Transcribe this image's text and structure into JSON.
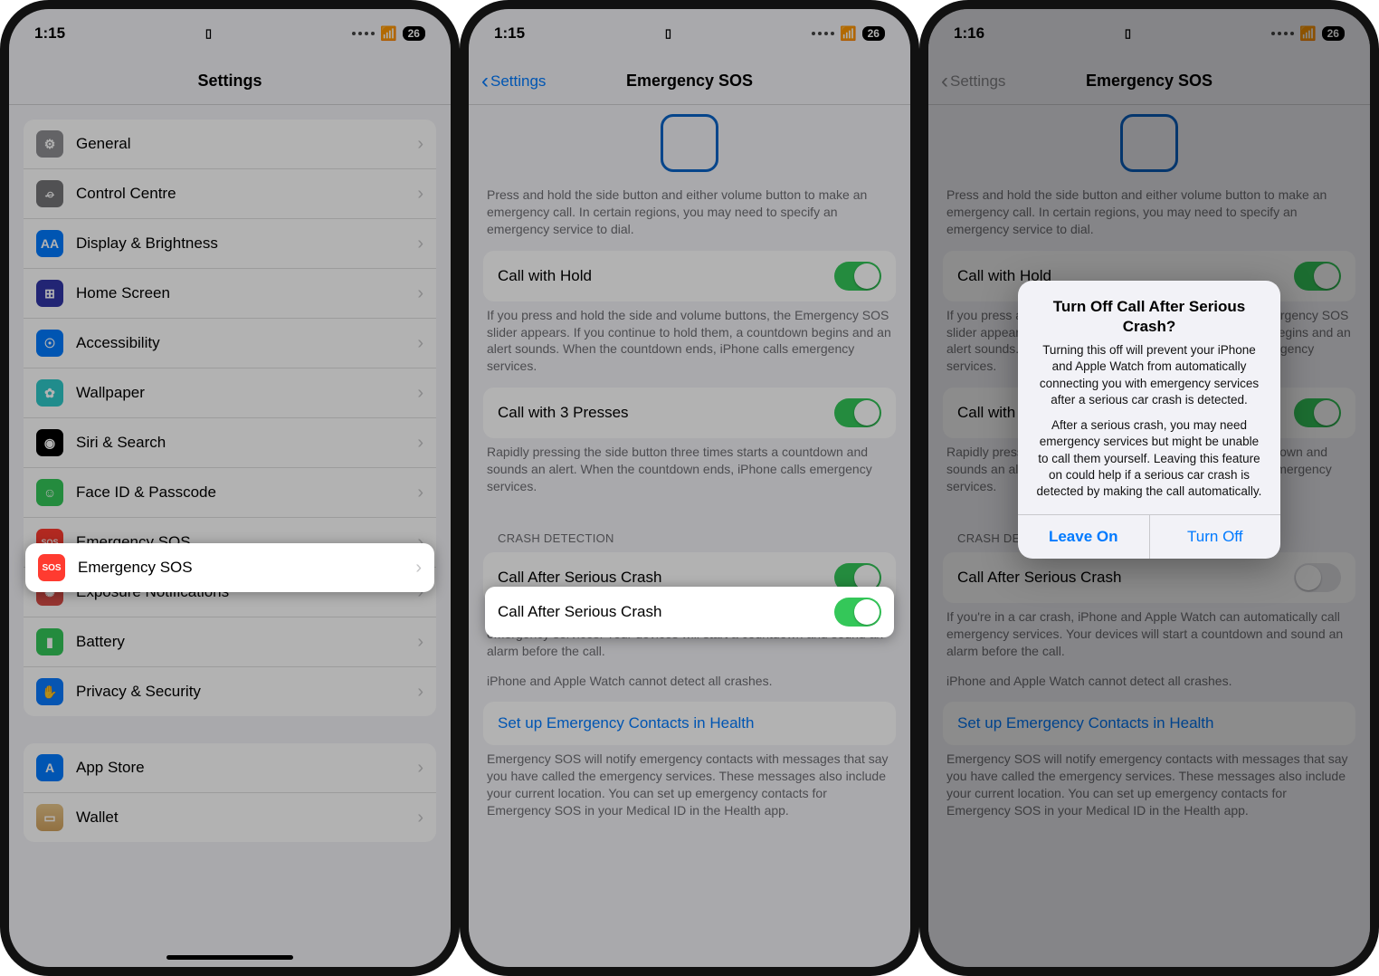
{
  "status": {
    "time1": "1:15",
    "time2": "1:15",
    "time3": "1:16",
    "batt": "26"
  },
  "s1": {
    "title": "Settings",
    "items": [
      {
        "label": "General",
        "icon": "gear",
        "cls": "ic-grey",
        "glyph": "⚙︎"
      },
      {
        "label": "Control Centre",
        "icon": "control",
        "cls": "ic-grey2",
        "glyph": "⌮"
      },
      {
        "label": "Display & Brightness",
        "icon": "display",
        "cls": "ic-blue",
        "glyph": "AA"
      },
      {
        "label": "Home Screen",
        "icon": "home",
        "cls": "ic-indigo",
        "glyph": "⊞"
      },
      {
        "label": "Accessibility",
        "icon": "accessibility",
        "cls": "ic-blue",
        "glyph": "☉"
      },
      {
        "label": "Wallpaper",
        "icon": "wallpaper",
        "cls": "ic-cyan",
        "glyph": "✿"
      },
      {
        "label": "Siri & Search",
        "icon": "siri",
        "cls": "ic-black",
        "glyph": "◉"
      },
      {
        "label": "Face ID & Passcode",
        "icon": "faceid",
        "cls": "ic-green",
        "glyph": "☺"
      },
      {
        "label": "Emergency SOS",
        "icon": "sos",
        "cls": "ic-red",
        "glyph": "SOS"
      },
      {
        "label": "Exposure Notifications",
        "icon": "exposure",
        "cls": "ic-dred",
        "glyph": "✺"
      },
      {
        "label": "Battery",
        "icon": "battery",
        "cls": "ic-green",
        "glyph": "▮"
      },
      {
        "label": "Privacy & Security",
        "icon": "privacy",
        "cls": "ic-bluep",
        "glyph": "✋"
      }
    ],
    "items2": [
      {
        "label": "App Store",
        "icon": "appstore",
        "cls": "ic-blue",
        "glyph": "A"
      },
      {
        "label": "Wallet",
        "icon": "wallet",
        "cls": "ic-orange",
        "glyph": "▭"
      }
    ]
  },
  "s2": {
    "back": "Settings",
    "title": "Emergency SOS",
    "hold_desc": "Press and hold the side button and either volume button to make an emergency call. In certain regions, you may need to specify an emergency service to dial.",
    "call_hold": "Call with Hold",
    "call_hold_desc": "If you press and hold the side and volume buttons, the Emergency SOS slider appears. If you continue to hold them, a countdown begins and an alert sounds. When the countdown ends, iPhone calls emergency services.",
    "call_3": "Call with 3 Presses",
    "call_3_desc": "Rapidly pressing the side button three times starts a countdown and sounds an alert. When the countdown ends, iPhone calls emergency services.",
    "crash_section": "CRASH DETECTION",
    "crash": "Call After Serious Crash",
    "crash_desc": "If you're in a car crash, iPhone and Apple Watch can automatically call emergency services. Your devices will start a countdown and sound an alarm before the call.",
    "crash_note": "iPhone and Apple Watch cannot detect all crashes.",
    "link": "Set up Emergency Contacts in Health",
    "foot": "Emergency SOS will notify emergency contacts with messages that say you have called the emergency services. These messages also include your current location. You can set up emergency contacts for Emergency SOS in your Medical ID in the Health app."
  },
  "alert": {
    "title": "Turn Off Call After Serious Crash?",
    "p1": "Turning this off will prevent your iPhone and Apple Watch from automatically connecting you with emergency services after a serious car crash is detected.",
    "p2": "After a serious crash, you may need emergency services but might be unable to call them yourself. Leaving this feature on could help if a serious car crash is detected by making the call automatically.",
    "leave": "Leave On",
    "off": "Turn Off"
  }
}
